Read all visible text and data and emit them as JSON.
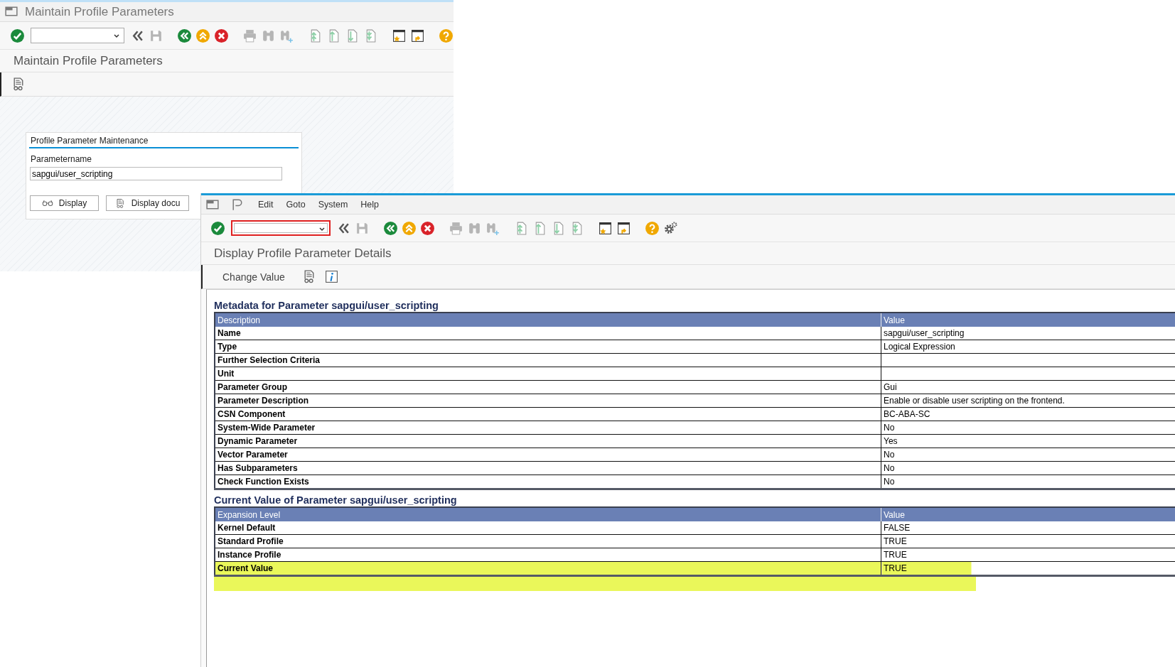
{
  "back_window": {
    "title": "Maintain Profile Parameters",
    "command_field": {
      "focused": false
    },
    "toolbar": [
      {
        "kind": "enter",
        "disabled": false
      },
      {
        "kind": "hide",
        "disabled": false
      },
      {
        "kind": "save",
        "disabled": true
      },
      {
        "kind": "back",
        "disabled": false
      },
      {
        "kind": "exit",
        "disabled": false
      },
      {
        "kind": "cancel",
        "disabled": false
      },
      {
        "kind": "print",
        "disabled": true
      },
      {
        "kind": "find",
        "disabled": true
      },
      {
        "kind": "find-next",
        "disabled": true
      },
      {
        "kind": "first",
        "disabled": true
      },
      {
        "kind": "prev",
        "disabled": true
      },
      {
        "kind": "next",
        "disabled": true
      },
      {
        "kind": "last",
        "disabled": true
      },
      {
        "kind": "new-session",
        "disabled": false
      },
      {
        "kind": "shortcut",
        "disabled": false
      },
      {
        "kind": "help",
        "disabled": false
      }
    ],
    "screen_title": "Maintain Profile Parameters",
    "group": {
      "title": "Profile Parameter Maintenance",
      "field_label": "Parametername",
      "field_value": "sapgui/user_scripting",
      "buttons": [
        {
          "kind": "display",
          "label": "Display"
        },
        {
          "kind": "docu",
          "label": "Display docu"
        }
      ]
    }
  },
  "front_window": {
    "menu": [
      "Edit",
      "Goto",
      "System",
      "Help"
    ],
    "command_field": {
      "focused": true
    },
    "toolbar": [
      {
        "kind": "enter",
        "disabled": false
      },
      {
        "kind": "hide",
        "disabled": false
      },
      {
        "kind": "save",
        "disabled": true
      },
      {
        "kind": "back",
        "disabled": false
      },
      {
        "kind": "exit",
        "disabled": false
      },
      {
        "kind": "cancel",
        "disabled": false
      },
      {
        "kind": "print",
        "disabled": true
      },
      {
        "kind": "find",
        "disabled": true
      },
      {
        "kind": "find-next",
        "disabled": true
      },
      {
        "kind": "first",
        "disabled": true
      },
      {
        "kind": "prev",
        "disabled": true
      },
      {
        "kind": "next",
        "disabled": true
      },
      {
        "kind": "last",
        "disabled": true
      },
      {
        "kind": "new-session",
        "disabled": false
      },
      {
        "kind": "shortcut",
        "disabled": false
      },
      {
        "kind": "help",
        "disabled": false
      },
      {
        "kind": "settings",
        "disabled": false
      }
    ],
    "screen_title": "Display Profile Parameter Details",
    "app_toolbar": [
      "Change Value"
    ],
    "sections": [
      {
        "title": "Metadata for Parameter sapgui/user_scripting",
        "columns": [
          "Description",
          "Value"
        ],
        "rows": [
          {
            "label": "Name",
            "value": "sapgui/user_scripting",
            "highlighted": false
          },
          {
            "label": "Type",
            "value": "Logical Expression",
            "highlighted": false
          },
          {
            "label": "Further Selection Criteria",
            "highlighted": false
          },
          {
            "label": "Unit",
            "highlighted": false
          },
          {
            "label": "Parameter Group",
            "value": "Gui",
            "highlighted": false
          },
          {
            "label": "Parameter Description",
            "value": "Enable or disable user scripting on the frontend.",
            "highlighted": false
          },
          {
            "label": "CSN Component",
            "value": "BC-ABA-SC",
            "highlighted": false
          },
          {
            "label": "System-Wide Parameter",
            "value": "No",
            "highlighted": false
          },
          {
            "label": "Dynamic Parameter",
            "value": "Yes",
            "highlighted": false
          },
          {
            "label": "Vector Parameter",
            "value": "No",
            "highlighted": false
          },
          {
            "label": "Has Subparameters",
            "value": "No",
            "highlighted": false
          },
          {
            "label": "Check Function Exists",
            "value": "No",
            "highlighted": false
          }
        ]
      },
      {
        "title": "Current Value of Parameter sapgui/user_scripting",
        "columns": [
          "Expansion Level",
          "Value"
        ],
        "rows": [
          {
            "label": "Kernel Default",
            "value": "FALSE",
            "highlighted": false
          },
          {
            "label": "Standard Profile",
            "value": "TRUE",
            "highlighted": false
          },
          {
            "label": "Instance Profile",
            "value": "TRUE",
            "highlighted": false
          },
          {
            "label": "Current Value",
            "value": "TRUE",
            "highlighted": true
          }
        ]
      }
    ]
  }
}
